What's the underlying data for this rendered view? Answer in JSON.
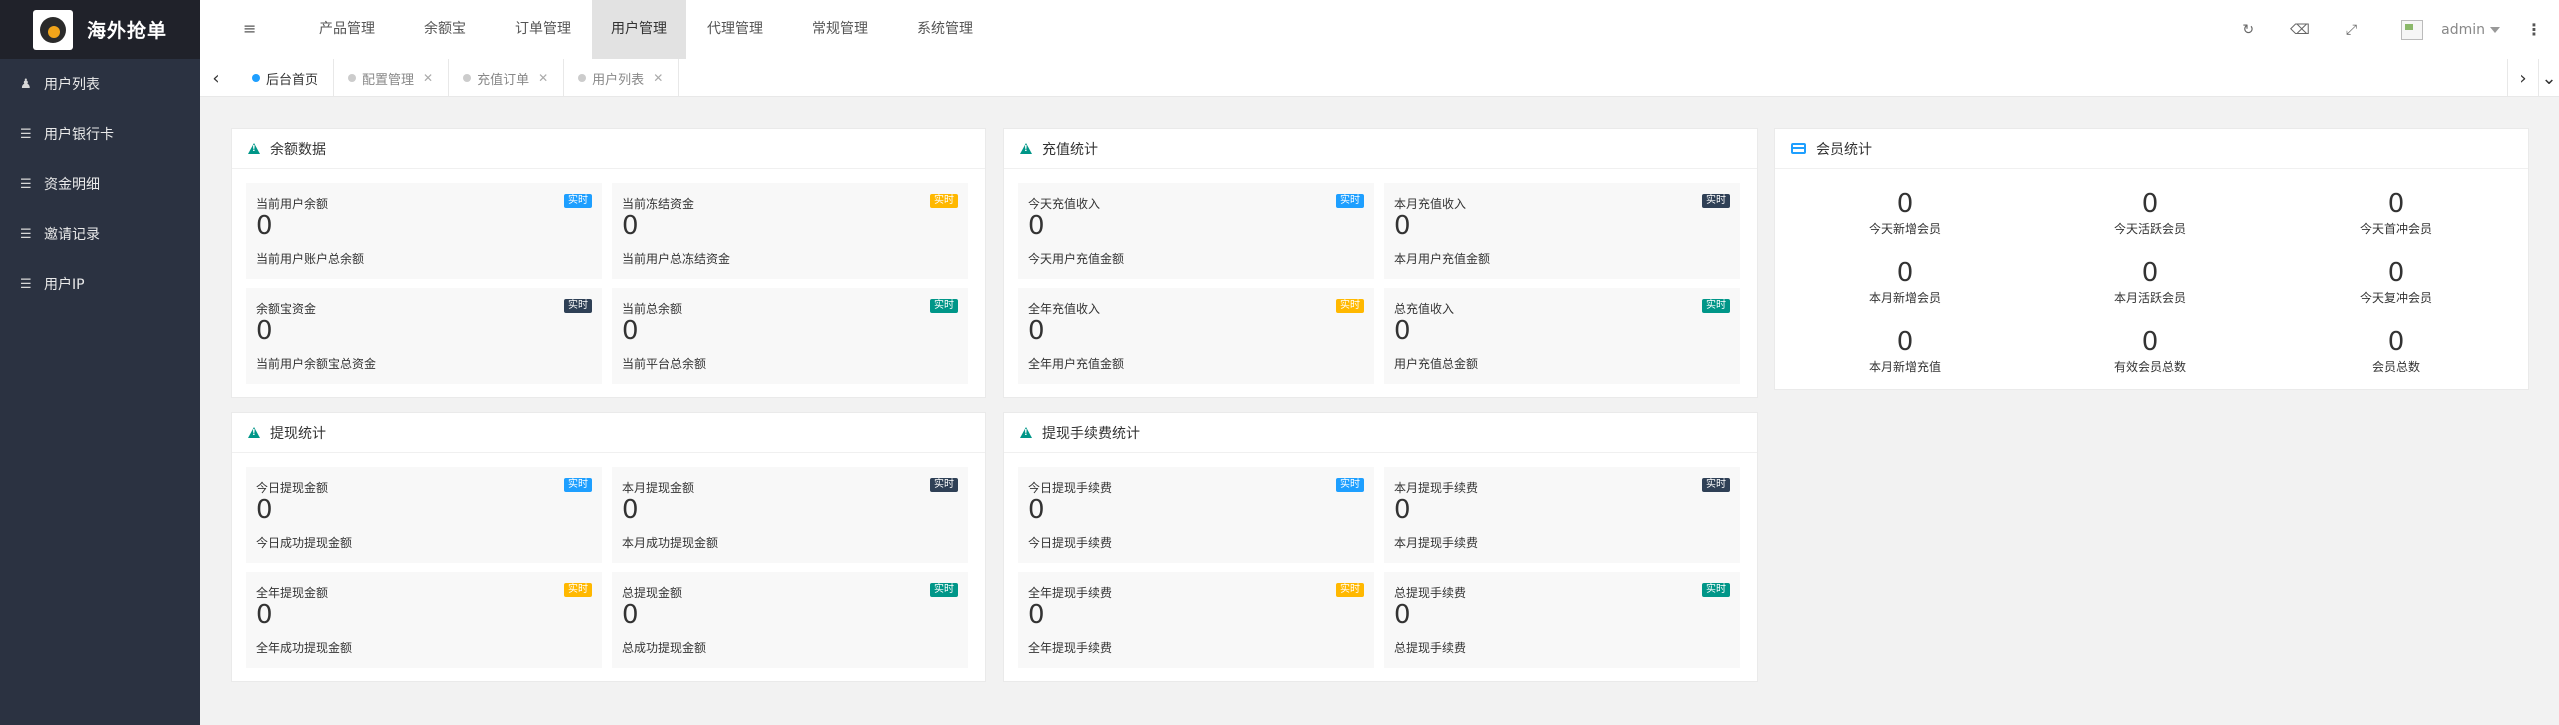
{
  "app": {
    "title": "海外抢单"
  },
  "sidebar": {
    "items": [
      {
        "label": "用户列表",
        "icon": "users-icon"
      },
      {
        "label": "用户银行卡",
        "icon": "list-icon"
      },
      {
        "label": "资金明细",
        "icon": "list-icon"
      },
      {
        "label": "邀请记录",
        "icon": "list-icon"
      },
      {
        "label": "用户IP",
        "icon": "list-icon"
      }
    ]
  },
  "header": {
    "nav": [
      {
        "label": "产品管理"
      },
      {
        "label": "余额宝"
      },
      {
        "label": "订单管理"
      },
      {
        "label": "用户管理",
        "active": true
      },
      {
        "label": "代理管理"
      },
      {
        "label": "常规管理"
      },
      {
        "label": "系统管理"
      }
    ],
    "username": "admin"
  },
  "tabs": [
    {
      "label": "后台首页",
      "active": true
    },
    {
      "label": "配置管理",
      "close": "✕"
    },
    {
      "label": "充值订单",
      "close": "✕"
    },
    {
      "label": "用户列表",
      "close": "✕"
    }
  ],
  "panels": {
    "balance": {
      "title": "余额数据",
      "stats": [
        {
          "label": "当前用户余额",
          "value": "0",
          "sub": "当前用户账户总余额",
          "badge": "实时",
          "badge_color": "blue"
        },
        {
          "label": "当前冻结资金",
          "value": "0",
          "sub": "当前用户总冻结资金",
          "badge": "实时",
          "badge_color": "orange"
        },
        {
          "label": "余额宝资金",
          "value": "0",
          "sub": "当前用户余额宝总资金",
          "badge": "实时",
          "badge_color": "dark"
        },
        {
          "label": "当前总余额",
          "value": "0",
          "sub": "当前平台总余额",
          "badge": "实时",
          "badge_color": "green"
        }
      ]
    },
    "recharge": {
      "title": "充值统计",
      "stats": [
        {
          "label": "今天充值收入",
          "value": "0",
          "sub": "今天用户充值金额",
          "badge": "实时",
          "badge_color": "blue"
        },
        {
          "label": "本月充值收入",
          "value": "0",
          "sub": "本月用户充值金额",
          "badge": "实时",
          "badge_color": "dark"
        },
        {
          "label": "全年充值收入",
          "value": "0",
          "sub": "全年用户充值金额",
          "badge": "实时",
          "badge_color": "orange"
        },
        {
          "label": "总充值收入",
          "value": "0",
          "sub": "用户充值总金额",
          "badge": "实时",
          "badge_color": "green"
        }
      ]
    },
    "member": {
      "title": "会员统计",
      "cells": [
        {
          "value": "0",
          "label": "今天新增会员"
        },
        {
          "value": "0",
          "label": "今天活跃会员"
        },
        {
          "value": "0",
          "label": "今天首冲会员"
        },
        {
          "value": "0",
          "label": "本月新增会员"
        },
        {
          "value": "0",
          "label": "本月活跃会员"
        },
        {
          "value": "0",
          "label": "今天复冲会员"
        },
        {
          "value": "0",
          "label": "本月新增充值"
        },
        {
          "value": "0",
          "label": "有效会员总数"
        },
        {
          "value": "0",
          "label": "会员总数"
        }
      ]
    },
    "withdraw": {
      "title": "提现统计",
      "stats": [
        {
          "label": "今日提现金额",
          "value": "0",
          "sub": "今日成功提现金额",
          "badge": "实时",
          "badge_color": "blue"
        },
        {
          "label": "本月提现金额",
          "value": "0",
          "sub": "本月成功提现金额",
          "badge": "实时",
          "badge_color": "dark"
        },
        {
          "label": "全年提现金额",
          "value": "0",
          "sub": "全年成功提现金额",
          "badge": "实时",
          "badge_color": "orange"
        },
        {
          "label": "总提现金额",
          "value": "0",
          "sub": "总成功提现金额",
          "badge": "实时",
          "badge_color": "green"
        }
      ]
    },
    "withdraw_fee": {
      "title": "提现手续费统计",
      "stats": [
        {
          "label": "今日提现手续费",
          "value": "0",
          "sub": "今日提现手续费",
          "badge": "实时",
          "badge_color": "blue"
        },
        {
          "label": "本月提现手续费",
          "value": "0",
          "sub": "本月提现手续费",
          "badge": "实时",
          "badge_color": "dark"
        },
        {
          "label": "全年提现手续费",
          "value": "0",
          "sub": "全年提现手续费",
          "badge": "实时",
          "badge_color": "orange"
        },
        {
          "label": "总提现手续费",
          "value": "0",
          "sub": "总提现手续费",
          "badge": "实时",
          "badge_color": "green"
        }
      ]
    }
  }
}
